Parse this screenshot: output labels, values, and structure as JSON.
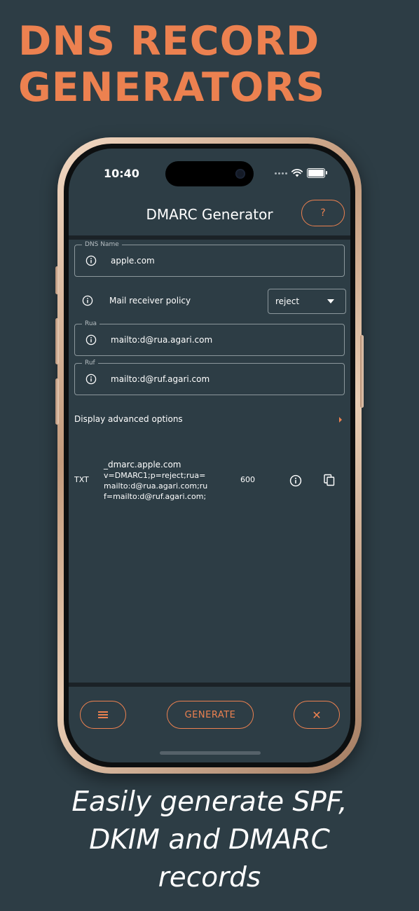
{
  "promo": {
    "headline_line1": "DNS RECORD",
    "headline_line2": "GENERATORS",
    "tagline_line1": "Easily generate SPF,",
    "tagline_line2": "DKIM and DMARC",
    "tagline_line3": "records"
  },
  "status_bar": {
    "time": "10:40",
    "icons": [
      "cellular-dots-icon",
      "wifi-icon",
      "battery-icon"
    ]
  },
  "header": {
    "title": "DMARC Generator",
    "help_label": "?"
  },
  "form": {
    "dns_name": {
      "label": "DNS Name",
      "value": "apple.com"
    },
    "policy": {
      "label": "Mail receiver policy",
      "value": "reject"
    },
    "rua": {
      "label": "Rua",
      "value": "mailto:d@rua.agari.com"
    },
    "ruf": {
      "label": "Ruf",
      "value": "mailto:d@ruf.agari.com"
    },
    "advanced_label": "Display advanced options"
  },
  "record": {
    "type": "TXT",
    "name": "_dmarc.apple.com",
    "value": "v=DMARC1;p=reject;rua=mailto:d@rua.agari.com;ruf=mailto:d@ruf.agari.com;",
    "ttl": "600"
  },
  "bottom_bar": {
    "generate_label": "GENERATE",
    "close_label": "✕"
  },
  "colors": {
    "background": "#2d3d45",
    "accent": "#ec8150",
    "text": "#ffffff",
    "divider": "#1b2227"
  }
}
